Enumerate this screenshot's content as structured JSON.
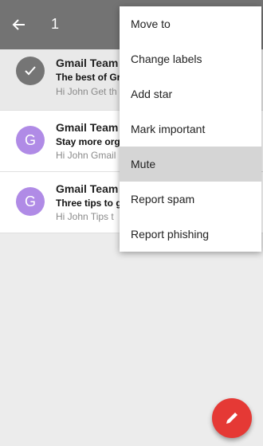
{
  "appbar": {
    "back_icon": "arrow-left-icon",
    "selected_count": "1"
  },
  "emails": [
    {
      "sender": "Gmail Team",
      "subject": "The best of Gr",
      "snippet": "Hi John Get th",
      "avatar": "check-icon"
    },
    {
      "sender": "Gmail Team",
      "subject": "Stay more org",
      "snippet": "Hi John Gmail",
      "avatar": "G"
    },
    {
      "sender": "Gmail Team",
      "subject": "Three tips to g",
      "snippet": "Hi John Tips t",
      "avatar": "G"
    }
  ],
  "menu": {
    "items": [
      "Move to",
      "Change labels",
      "Add star",
      "Mark important",
      "Mute",
      "Report spam",
      "Report phishing"
    ],
    "highlighted": "Mute"
  },
  "fab": {
    "icon": "pencil-icon",
    "color": "#e53935"
  },
  "colors": {
    "appbar": "#737373",
    "avatar_letter": "#b08be6",
    "avatar_check": "#757575"
  }
}
